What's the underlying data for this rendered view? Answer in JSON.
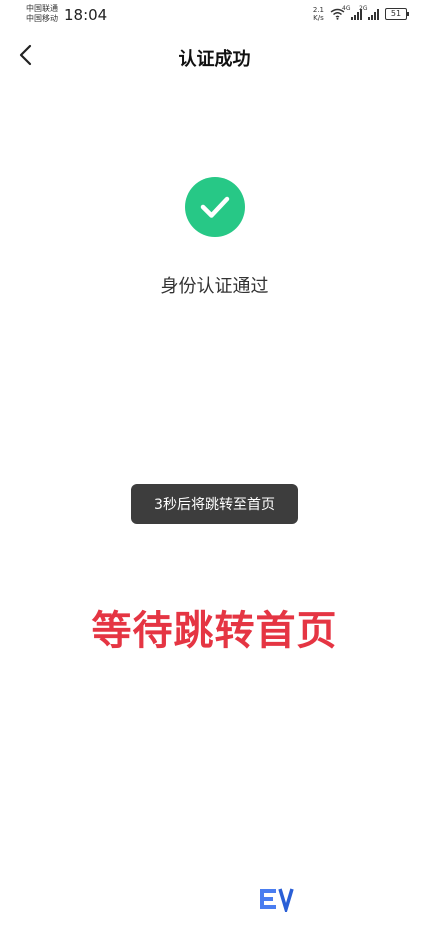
{
  "status_bar": {
    "carrier_1": "中国联通",
    "carrier_2": "中国移动",
    "time": "18:04",
    "net_speed_value": "2.1",
    "net_speed_unit": "K/s",
    "signal_1_type": "4G",
    "signal_2_type": "2G",
    "battery": "51"
  },
  "nav": {
    "title": "认证成功"
  },
  "result": {
    "message": "身份认证通过",
    "icon": "check-icon",
    "accent_color": "#27c886"
  },
  "toast": {
    "text": "3秒后将跳转至首页"
  },
  "caption": {
    "text": "等待跳转首页",
    "color": "#e53543"
  }
}
